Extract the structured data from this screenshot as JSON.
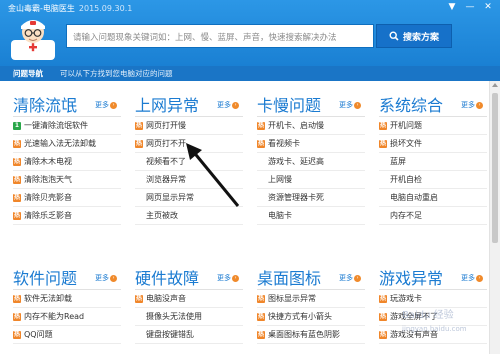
{
  "window": {
    "title": "金山毒霸-电脑医生",
    "version": "2015.09.30.1",
    "controls": [
      "▼",
      "—",
      "✕"
    ]
  },
  "search": {
    "placeholder": "请输入问题现象关键词如：上网、慢、蓝屏、声音，快速搜索解决办法",
    "button_label": "搜索方案"
  },
  "nav": {
    "title": "问题导航",
    "description": "可以从下方找到您电脑对应的问题"
  },
  "more_label": "更多",
  "categories": [
    {
      "title": "清除流氓",
      "items": [
        {
          "label": "一键清除流氓软件",
          "badge": "green"
        },
        {
          "label": "光速输入法无法卸载",
          "badge": "orange"
        },
        {
          "label": "清除木木电视",
          "badge": "orange"
        },
        {
          "label": "清除泡泡天气",
          "badge": "orange"
        },
        {
          "label": "清除贝壳影音",
          "badge": "orange"
        },
        {
          "label": "清除乐乏影音",
          "badge": "orange"
        }
      ]
    },
    {
      "title": "上网异常",
      "items": [
        {
          "label": "网页打开慢",
          "badge": "orange"
        },
        {
          "label": "网页打不开",
          "badge": "orange"
        },
        {
          "label": "视频看不了",
          "badge": ""
        },
        {
          "label": "浏览器异常",
          "badge": ""
        },
        {
          "label": "网页显示异常",
          "badge": ""
        },
        {
          "label": "主页被改",
          "badge": ""
        }
      ]
    },
    {
      "title": "卡慢问题",
      "items": [
        {
          "label": "开机卡、启动慢",
          "badge": "orange"
        },
        {
          "label": "看视频卡",
          "badge": "orange"
        },
        {
          "label": "游戏卡、延迟高",
          "badge": ""
        },
        {
          "label": "上网慢",
          "badge": ""
        },
        {
          "label": "资源管理器卡死",
          "badge": ""
        },
        {
          "label": "电脑卡",
          "badge": ""
        }
      ]
    },
    {
      "title": "系统综合",
      "items": [
        {
          "label": "开机问题",
          "badge": "orange"
        },
        {
          "label": "损坏文件",
          "badge": "orange"
        },
        {
          "label": "蓝屏",
          "badge": ""
        },
        {
          "label": "开机自检",
          "badge": ""
        },
        {
          "label": "电脑自动重启",
          "badge": ""
        },
        {
          "label": "内存不足",
          "badge": ""
        }
      ]
    },
    {
      "title": "软件问题",
      "items": [
        {
          "label": "软件无法卸载",
          "badge": "orange"
        },
        {
          "label": "内存不能为Read",
          "badge": "orange"
        },
        {
          "label": "QQ问题",
          "badge": "orange"
        }
      ]
    },
    {
      "title": "硬件故障",
      "items": [
        {
          "label": "电脑没声音",
          "badge": "orange"
        },
        {
          "label": "摄像头无法使用",
          "badge": ""
        },
        {
          "label": "键盘按键错乱",
          "badge": ""
        }
      ]
    },
    {
      "title": "桌面图标",
      "items": [
        {
          "label": "图标显示异常",
          "badge": "orange"
        },
        {
          "label": "快捷方式有小箭头",
          "badge": "orange"
        },
        {
          "label": "桌面图标有蓝色阴影",
          "badge": "orange"
        }
      ]
    },
    {
      "title": "游戏异常",
      "items": [
        {
          "label": "玩游戏卡",
          "badge": "orange"
        },
        {
          "label": "游戏全屏不了",
          "badge": "orange"
        },
        {
          "label": "游戏没有声音",
          "badge": "orange"
        }
      ]
    }
  ],
  "watermark": {
    "text": "Baidu 经验",
    "url_text": "jingyan.baidu.com"
  },
  "colors": {
    "header": "#2c97e6",
    "navbar": "#1a75c6",
    "category_title": "#1b7bd1",
    "badge_orange": "#f0862a",
    "badge_green": "#2aa74a",
    "search_button": "#1671c9"
  },
  "icons": {
    "logo": "doctor-avatar-icon",
    "search_button": "search-icon",
    "badge_orange": "hot-badge-icon",
    "badge_green": "one-click-badge-icon",
    "more": "more-arrow-icon",
    "annotation": "arrow-pointer-icon"
  }
}
